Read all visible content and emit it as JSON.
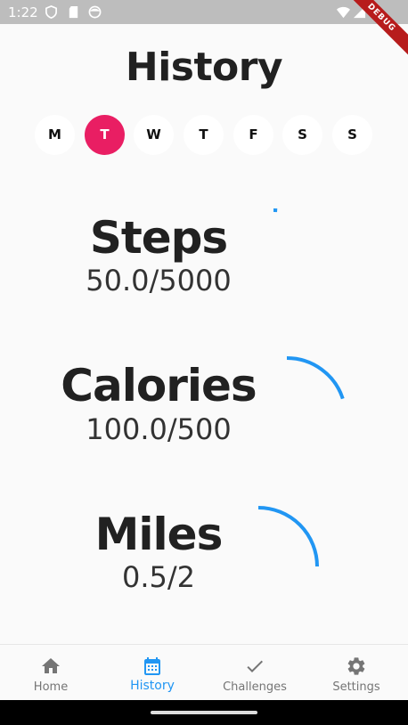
{
  "status_bar": {
    "time": "1:22",
    "icons": [
      "shield-icon",
      "sd-card-icon",
      "face-icon",
      "wifi-icon",
      "signal-icon",
      "battery-icon"
    ],
    "debug_banner": "DEBUG"
  },
  "page": {
    "title": "History"
  },
  "days": [
    {
      "label": "M",
      "selected": false
    },
    {
      "label": "T",
      "selected": true
    },
    {
      "label": "W",
      "selected": false
    },
    {
      "label": "T",
      "selected": false
    },
    {
      "label": "F",
      "selected": false
    },
    {
      "label": "S",
      "selected": false
    },
    {
      "label": "S",
      "selected": false
    }
  ],
  "metrics": [
    {
      "title": "Steps",
      "value": "50.0/5000",
      "progress": 0.01
    },
    {
      "title": "Calories",
      "value": "100.0/500",
      "progress": 0.2
    },
    {
      "title": "Miles",
      "value": "0.5/2",
      "progress": 0.25
    }
  ],
  "bottom_nav": [
    {
      "label": "Home",
      "icon": "home-icon",
      "active": false
    },
    {
      "label": "History",
      "icon": "calendar-icon",
      "active": true
    },
    {
      "label": "Challenges",
      "icon": "check-icon",
      "active": false
    },
    {
      "label": "Settings",
      "icon": "gear-icon",
      "active": false
    }
  ],
  "colors": {
    "accent": "#2196f3",
    "selected_day": "#e91e63",
    "background": "#fafafa"
  }
}
